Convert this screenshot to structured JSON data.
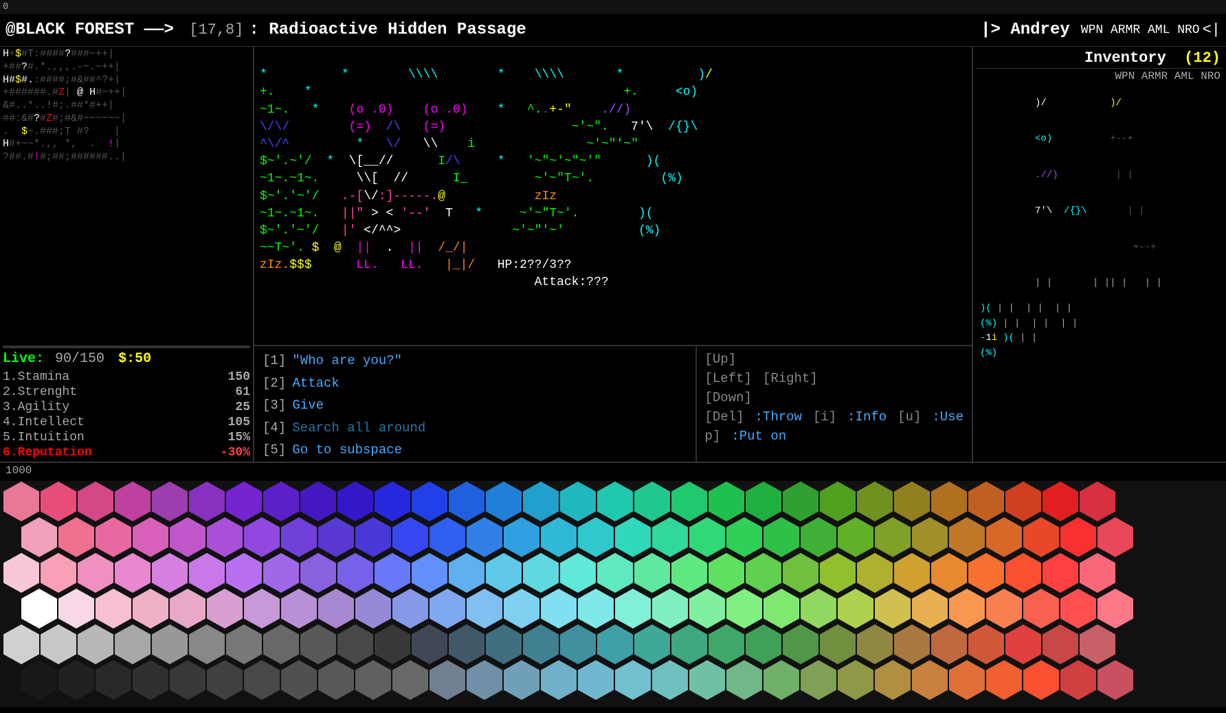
{
  "window": {
    "title": "0"
  },
  "header": {
    "location": "@BLACK FOREST",
    "arrow": "——>",
    "coords": "[17,8]",
    "colon": ":",
    "area_name": "Radioactive Hidden Passage",
    "separator": "|>",
    "player_name": "Andrey",
    "close": "<|",
    "stat_labels": "WPN ARMR AML NRO"
  },
  "left_panel": {
    "map_lines": [
      "H+$#T:####?###~++|",
      "+##?#.*.,,,.-~.~++|",
      "H#$#.:####;#&##^?+|",
      "+######.#Z| @ H#~++|",
      "&#..*..!#;.##*#++|",
      "##:&#?#Z#;#&#~~~~~~|",
      ".  $~.###;T #?    |",
      "H#+~~*.,, *,  .  !|",
      "?##.#!#;##;######..|"
    ],
    "live_label": "Live:",
    "live_hp": "90/150",
    "live_money": "$:50",
    "stats": [
      {
        "num": "1.",
        "name": "Stamina",
        "value": "150"
      },
      {
        "num": "2.",
        "name": "Strenght",
        "value": "61"
      },
      {
        "num": "3.",
        "name": "Agility",
        "value": "25"
      },
      {
        "num": "4.",
        "name": "Intellect",
        "value": "105"
      },
      {
        "num": "5.",
        "name": "Intuition",
        "value": "15%"
      },
      {
        "num": "6.",
        "name": "Reputation",
        "value": "-30%",
        "name_color": "red",
        "value_color": "red"
      }
    ]
  },
  "center_panel": {
    "ascii_art": "complex roguelike ascii art display",
    "enemy1": {
      "face": "(o .0)",
      "body": "(=)"
    },
    "enemy2": {
      "face": "(o .0)",
      "body": "(=)"
    },
    "player_char": "@",
    "npc_chars": [
      "i",
      "I",
      "I_",
      "T",
      "zIz"
    ],
    "hp_display": "HP:2??/3??",
    "attack_display": "Attack:???"
  },
  "action_menu": {
    "items": [
      {
        "num": "[1]",
        "label": "\"Who are you?\"",
        "dim": false
      },
      {
        "num": "[2]",
        "label": "Attack",
        "dim": false
      },
      {
        "num": "[3]",
        "label": "Give",
        "dim": false
      },
      {
        "num": "[4]",
        "label": "Search all around",
        "dim": true
      },
      {
        "num": "[5]",
        "label": "Go to subspace",
        "dim": false
      }
    ],
    "keys": [
      {
        "key": "[Up]"
      },
      {
        "key": "[Left]",
        "label": ""
      },
      {
        "key": "[Right]"
      },
      {
        "key": "[Down]"
      },
      {
        "key": "[Del]",
        "label": "Throw"
      },
      {
        "key": "[i]",
        "label": "Info"
      },
      {
        "key": "[u]",
        "label": "Use"
      },
      {
        "key": "p]",
        "label": "Put on"
      }
    ]
  },
  "right_panel": {
    "inventory_label": "Inventory",
    "inventory_count": "(12)",
    "wpn_labels": "WPN ARMR AML NRO",
    "items": [
      {
        "symbol": ")/{",
        "color": "yellow"
      },
      {
        "symbol": "<o)",
        "color": "yellow"
      },
      {
        "symbol": ".//)",
        "color": "purple"
      },
      {
        "symbol": "{}",
        "color": "cyan"
      },
      {
        "symbol": ")(",
        "color": "cyan"
      },
      {
        "symbol": "(%)",
        "color": "cyan"
      },
      {
        "symbol": ")(",
        "color": "cyan"
      },
      {
        "symbol": "(%)",
        "color": "cyan"
      }
    ],
    "inv_num1": "7",
    "inv_num2": "1i"
  },
  "status_bar": {
    "value": "1000"
  },
  "palette": {
    "colors": [
      "#e87895",
      "#e84d7a",
      "#d44884",
      "#c040a0",
      "#9c3db0",
      "#8830c0",
      "#7425d0",
      "#5c20c8",
      "#4418c0",
      "#3418c8",
      "#2828e0",
      "#2040e8",
      "#2060e0",
      "#2080d8",
      "#20a0cc",
      "#20b8c0",
      "#20c8b0",
      "#20c890",
      "#20c870",
      "#20c050",
      "#20b040",
      "#30a030",
      "#50a020",
      "#709020",
      "#908020",
      "#b07020",
      "#c06020",
      "#d04020",
      "#e02020",
      "#d83040",
      "#f0a0b8",
      "#f07090",
      "#e868a0",
      "#d860b8",
      "#c058cc",
      "#a850d8",
      "#9048e0",
      "#7040d8",
      "#5838d0",
      "#4838d8",
      "#3848f0",
      "#3060f0",
      "#3080e8",
      "#30a0e0",
      "#30b8d8",
      "#30c8cc",
      "#30d8bc",
      "#30d89c",
      "#30d878",
      "#30d058",
      "#30c048",
      "#40b038",
      "#60b028",
      "#80a028",
      "#a09028",
      "#c07828",
      "#d86828",
      "#e84828",
      "#f83030",
      "#e84858",
      "#f8c8d8",
      "#f8a0b8",
      "#f090c0",
      "#e888d0",
      "#d880e0",
      "#c878e8",
      "#b870f0",
      "#a068e8",
      "#8860e0",
      "#7860e8",
      "#6878f8",
      "#6090f8",
      "#60b0f0",
      "#60c8e8",
      "#60d8e0",
      "#60e8d8",
      "#60e8c0",
      "#60e8a0",
      "#60e880",
      "#60e060",
      "#60d050",
      "#70c040",
      "#90c030",
      "#b0b030",
      "#d0a030",
      "#e88830",
      "#f87030",
      "#f85030",
      "#ff4040",
      "#f86878",
      "#ffffff",
      "#f8d8e8",
      "#f8c0d0",
      "#f0b0c8",
      "#e8a8c8",
      "#d8a0d0",
      "#c898d8",
      "#b890d8",
      "#a888d0",
      "#9888d8",
      "#8898e8",
      "#80a8f0",
      "#80c0f0",
      "#80d0f0",
      "#80e0f0",
      "#80e8e8",
      "#80f0d8",
      "#80f0c0",
      "#80f0a0",
      "#80f080",
      "#80e870",
      "#90d860",
      "#b0d050",
      "#d0c050",
      "#e8b050",
      "#f89850",
      "#f88050",
      "#f86050",
      "#ff5050",
      "#ff7888",
      "#d0d0d0",
      "#c8c8c8",
      "#b8b8b8",
      "#a8a8a8",
      "#989898",
      "#888888",
      "#787878",
      "#686868",
      "#585858",
      "#484848",
      "#383838",
      "#404858",
      "#405868",
      "#407080",
      "#408090",
      "#4090a0",
      "#40a0a8",
      "#40a898",
      "#40a880",
      "#40a868",
      "#40a058",
      "#509848",
      "#709040",
      "#908840",
      "#a87840",
      "#c06840",
      "#d05838",
      "#e04040",
      "#c84848",
      "#c86068",
      "#181818",
      "#202020",
      "#282828",
      "#303030",
      "#383838",
      "#404040",
      "#484848",
      "#505050",
      "#585858",
      "#606060",
      "#686868",
      "#708090",
      "#7090a8",
      "#70a0b8",
      "#70b0c8",
      "#70b8d0",
      "#70c0d0",
      "#70c0c0",
      "#70c0a8",
      "#70b888",
      "#70b068",
      "#80a058",
      "#909848",
      "#b09040",
      "#c88040",
      "#e07038",
      "#f06030",
      "#f85030",
      "#d04040",
      "#c85060"
    ]
  }
}
